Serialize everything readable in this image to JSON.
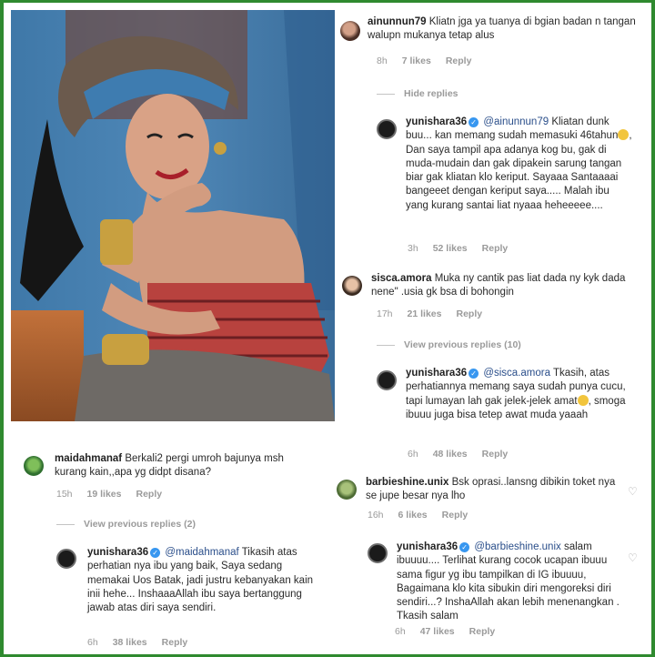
{
  "comments": {
    "c1": {
      "username": "ainunnun79",
      "text": "Kliatn jga ya tuanya di bgian badan n tangan walupn mukanya tetap alus",
      "time": "8h",
      "likes": "7 likes",
      "reply": "Reply"
    },
    "hide_replies": "Hide replies",
    "c2": {
      "username": "yunishara36",
      "mention": "@ainunnun79",
      "text_a": "Kliatan dunk buu... kan memang sudah memasuki 46tahun",
      "text_b": ", Dan saya tampil apa adanya kog bu, gak di muda-mudain dan gak dipakein sarung tangan biar gak kliatan klo keriput. Sayaaa Santaaaai bangeeet dengan keriput saya..... Malah ibu yang kurang santai liat nyaaa heheeeee....",
      "time": "3h",
      "likes": "52 likes",
      "reply": "Reply"
    },
    "c3": {
      "username": "sisca.amora",
      "text": "Muka ny cantik pas liat dada ny kyk dada nene\" .usia gk bsa di bohongin",
      "time": "17h",
      "likes": "21 likes",
      "reply": "Reply"
    },
    "view_prev_10": "View previous replies (10)",
    "c4": {
      "username": "yunishara36",
      "mention": "@sisca.amora",
      "text_a": "Tkasih, atas perhatiannya memang saya sudah punya cucu, tapi lumayan lah gak jelek-jelek amat",
      "text_b": ", smoga ibuuu juga bisa tetep awat muda yaaah",
      "time": "6h",
      "likes": "48 likes",
      "reply": "Reply"
    },
    "c5": {
      "username": "barbieshine.unix",
      "text": "Bsk oprasi..lansng dibikin toket nya se jupe besar nya lho",
      "time": "16h",
      "likes": "6 likes",
      "reply": "Reply"
    },
    "c6": {
      "username": "yunishara36",
      "mention": "@barbieshine.unix",
      "text": "salam ibuuuu.... Terlihat kurang cocok ucapan ibuuu sama figur yg ibu tampilkan di IG ibuuuu, Bagaimana klo kita sibukin diri mengoreksi diri sendiri...? InshaAllah akan lebih menenangkan . Tkasih salam",
      "time": "6h",
      "likes": "47 likes",
      "reply": "Reply"
    },
    "c7": {
      "username": "maidahmanaf",
      "text": "Berkali2 pergi umroh bajunya msh kurang kain,,apa yg didpt disana?",
      "time": "15h",
      "likes": "19 likes",
      "reply": "Reply"
    },
    "view_prev_2": "View previous replies (2)",
    "c8": {
      "username": "yunishara36",
      "mention": "@maidahmanaf",
      "text": "Tikasih atas perhatian nya ibu yang baik, Saya sedang memakai Uos Batak, jadi justru kebanyakan kain inii hehe... InshaaaAllah ibu saya bertanggung jawab atas diri saya sendiri.",
      "time": "6h",
      "likes": "38 likes",
      "reply": "Reply"
    }
  },
  "icons": {
    "verified": "verified-badge-icon",
    "heart": "heart-icon",
    "emoji": "smiling-face-emoji"
  },
  "colors": {
    "frame": "#2f8a2f",
    "mention": "#2a4e8a",
    "verified": "#3897f0",
    "meta": "#9a9a9a"
  }
}
